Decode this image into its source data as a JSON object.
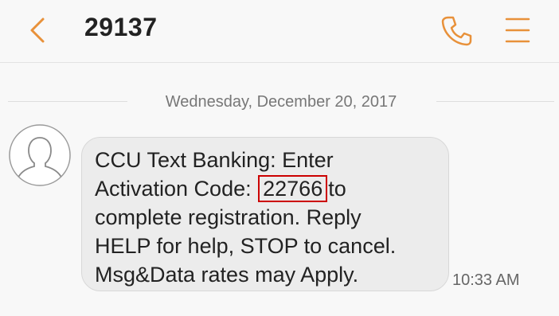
{
  "header": {
    "title": "29137",
    "back_icon": "chevron-left-icon",
    "call_icon": "phone-icon",
    "menu_icon": "menu-icon",
    "accent_color": "#e8913a"
  },
  "conversation": {
    "date": "Wednesday, December 20, 2017",
    "message": {
      "line1": "CCU Text Banking: Enter",
      "line2_prefix": "Activation Code:",
      "code": "22766",
      "line2_suffix": "to",
      "line3": "complete registration. Reply",
      "line4": "HELP for help, STOP to cancel.",
      "line5": "Msg&Data rates may Apply.",
      "time": "10:33 AM"
    }
  }
}
